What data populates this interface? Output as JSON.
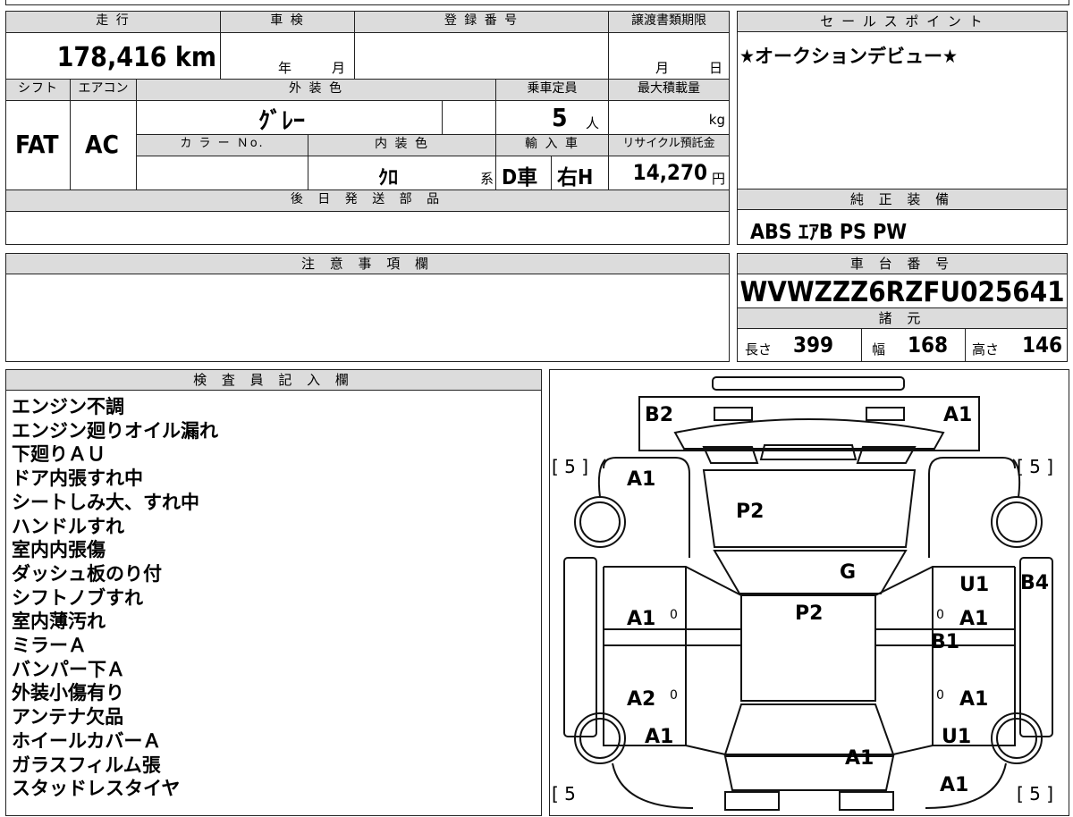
{
  "main_table": {
    "mileage_label": "走 行",
    "mileage_value": "178,416 km",
    "shaken_label": "車 検",
    "shaken_year": "年",
    "shaken_month": "月",
    "reg_no_label": "登 録 番 号",
    "transfer_label": "譲渡書類期限",
    "transfer_month": "月",
    "transfer_day": "日",
    "shift_label": "シフト",
    "shift_value": "FAT",
    "ac_label": "エアコン",
    "ac_value": "AC",
    "ext_color_label": "外 装 色",
    "ext_color_value": "ｸﾞﾚｰ",
    "capacity_label": "乗車定員",
    "capacity_value": "5",
    "capacity_unit": "人",
    "max_load_label": "最大積載量",
    "max_load_unit": "kg",
    "color_no_label": "カ ラ ー Ｎo.",
    "int_color_label": "内 装 色",
    "int_color_value": "ｸﾛ",
    "int_color_suffix": "系",
    "import_label": "輸 入 車",
    "import_d": "D車",
    "import_h": "右H",
    "recycle_label": "リサイクル預託金",
    "recycle_value": "14,270",
    "recycle_unit": "円",
    "later_parts_label": "後 日 発 送 部 品"
  },
  "sales_point": {
    "label": "セ ー ル ス ポ イ ン ト",
    "text": "★オークションデビュー★"
  },
  "equipment": {
    "label": "純 正 装 備",
    "text": "ABS ｴｱB PS PW"
  },
  "notes": {
    "label": "注 意 事 項 欄"
  },
  "chassis": {
    "label": "車 台 番 号",
    "value": "WVWZZZ6RZFU025641",
    "specs_label": "諸 元",
    "length_label": "長さ",
    "length_value": "399",
    "width_label": "幅",
    "width_value": "168",
    "height_label": "高さ",
    "height_value": "146"
  },
  "inspector": {
    "label": "検 査 員 記 入 欄",
    "items": [
      "エンジン不調",
      "エンジン廻りオイル漏れ",
      "下廻りＡＵ",
      "ドア内張すれ中",
      "シートしみ大、すれ中",
      "ハンドルすれ",
      "室内内張傷",
      "ダッシュ板のり付",
      "シフトノブすれ",
      "室内薄汚れ",
      "ミラーＡ",
      "バンパー下Ａ",
      "外装小傷有り",
      "アンテナ欠品",
      "ホイールカバーＡ",
      "ガラスフィルム張",
      "スタッドレスタイヤ"
    ]
  },
  "diagram": {
    "marks": {
      "front_left": "B2",
      "front_right": "A1",
      "left_fender": "A1",
      "hood": "P2",
      "windshield": "G",
      "roof": "P2",
      "right_front_door": "U1",
      "right_rear_quarter": "B4",
      "left_front_door": "A1",
      "right_front_door_2": "A1",
      "right_sill": "B1",
      "left_rear_door": "A2",
      "right_rear_door": "A1",
      "left_rear_fender": "A1",
      "right_rear_fender": "U1",
      "trunk": "A1",
      "rear_right": "A1"
    },
    "tire_tl": "[ 5 ]",
    "tire_tr": "[ 5 ]",
    "tire_bl": "[ 5",
    "tire_br": "[ 5 ]",
    "zero": "0"
  }
}
